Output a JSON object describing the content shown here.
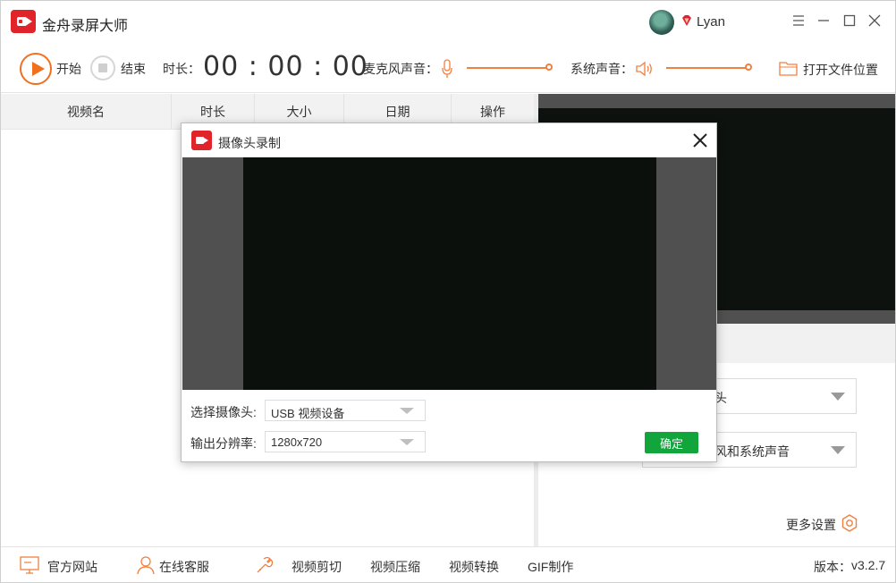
{
  "app": {
    "title": "金舟录屏大师",
    "user_name": "Lyan",
    "version_label": "版本：",
    "version": "v3.2.7"
  },
  "window_controls": {
    "menu_icon": "menu-icon",
    "minimize_icon": "minimize-icon",
    "maximize_icon": "maximize-icon",
    "close_icon": "close-icon"
  },
  "toolbar": {
    "start_label": "开始",
    "stop_label": "结束",
    "duration_label": "时长：",
    "timer": "00 : 00 : 00",
    "mic_label": "麦克风声音：",
    "mic_volume": 1.0,
    "system_label": "系统声音：",
    "system_volume": 1.0,
    "open_folder_label": "打开文件位置"
  },
  "table": {
    "columns": [
      "视频名",
      "时长",
      "大小",
      "日期",
      "操作"
    ],
    "rows": []
  },
  "right_panel": {
    "camera_select_partial": "头",
    "audio_select_partial": "风和系统声音",
    "more_settings_label": "更多设置"
  },
  "bottom_bar": {
    "items": [
      "官方网站",
      "在线客服",
      "视频剪切",
      "视频压缩",
      "视频转换",
      "GIF制作"
    ]
  },
  "modal": {
    "title": "摄像头录制",
    "camera_label": "选择摄像头:",
    "camera_value": "USB 视频设备",
    "resolution_label": "输出分辨率:",
    "resolution_value": "1280x720",
    "ok_label": "确定"
  },
  "colors": {
    "brand_red": "#e0242a",
    "accent_orange": "#f07020",
    "ok_green": "#11a53c",
    "preview_dark": "#0b100c"
  }
}
